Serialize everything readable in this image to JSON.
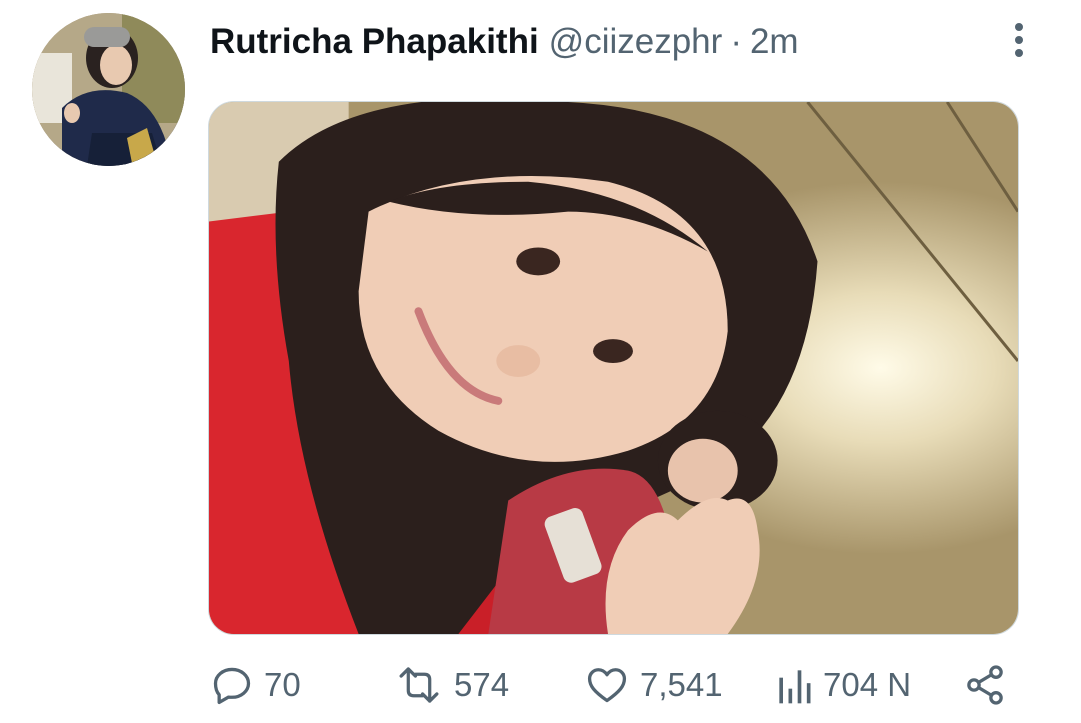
{
  "tweet": {
    "author": {
      "display_name": "Rutricha Phapakithi",
      "handle": "@ciizezphr",
      "separator": "·",
      "time": "2m",
      "avatar_icon": "avatar-photo"
    },
    "more_icon": "more-vertical-icon",
    "media": {
      "kind": "photo",
      "description_icon": "selfie-photo"
    },
    "actions": {
      "reply": {
        "icon": "reply-icon",
        "count": "70"
      },
      "retweet": {
        "icon": "retweet-icon",
        "count": "574"
      },
      "like": {
        "icon": "heart-icon",
        "count": "7,541"
      },
      "views": {
        "icon": "views-icon",
        "count": "704 N"
      },
      "share": {
        "icon": "share-icon"
      }
    }
  },
  "colors": {
    "text_primary": "#0f1419",
    "text_secondary": "#536471",
    "background": "#ffffff",
    "media_border": "#cfd9de"
  }
}
